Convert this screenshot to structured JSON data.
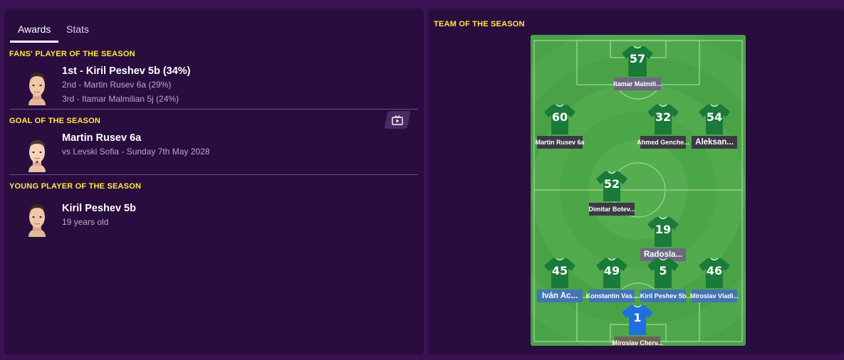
{
  "tabs": [
    {
      "label": "Awards",
      "active": true
    },
    {
      "label": "Stats",
      "active": false
    }
  ],
  "awards": {
    "fans_player": {
      "title": "FANS' PLAYER OF THE SEASON",
      "first": "1st - Kiril Peshev 5b (34%)",
      "second": "2nd - Martin Rusev 6a (29%)",
      "third": "3rd - Itamar Malmilian 5j (24%)"
    },
    "goal": {
      "title": "GOAL OF THE SEASON",
      "winner": "Martin Rusev 6a",
      "detail": "vs Levski Sofia - Sunday 7th May 2028",
      "video_icon": "tv-play-icon"
    },
    "young_player": {
      "title": "YOUNG PLAYER OF THE SEASON",
      "winner": "Kiril Peshev 5b",
      "detail": "19 years old"
    }
  },
  "team_of_season": {
    "title": "TEAM OF THE SEASON",
    "players": [
      {
        "number": "57",
        "name": "Itamar Malmili..."
      },
      {
        "number": "60",
        "name": "Martin Rusev 6a"
      },
      {
        "number": "32",
        "name": "Ahmed Genche..."
      },
      {
        "number": "54",
        "name": "Aleksan..."
      },
      {
        "number": "52",
        "name": "Dimitar Botev..."
      },
      {
        "number": "19",
        "name": "Radosla..."
      },
      {
        "number": "45",
        "name": "Iván Ac..."
      },
      {
        "number": "49",
        "name": "Konstantin Vas..."
      },
      {
        "number": "5",
        "name": "Kiril Peshev 5b"
      },
      {
        "number": "46",
        "name": "Miroslav Vladi..."
      },
      {
        "number": "1",
        "name": "Miroslav Cherv..."
      }
    ]
  },
  "colors": {
    "accent_yellow": "#ffea3d",
    "panel_bg": "#290d3f",
    "page_bg": "#3a1254",
    "shirt_green": "#1a7a3a",
    "keeper_blue": "#1f6fe0",
    "pitch_green": "#4ea84b"
  }
}
